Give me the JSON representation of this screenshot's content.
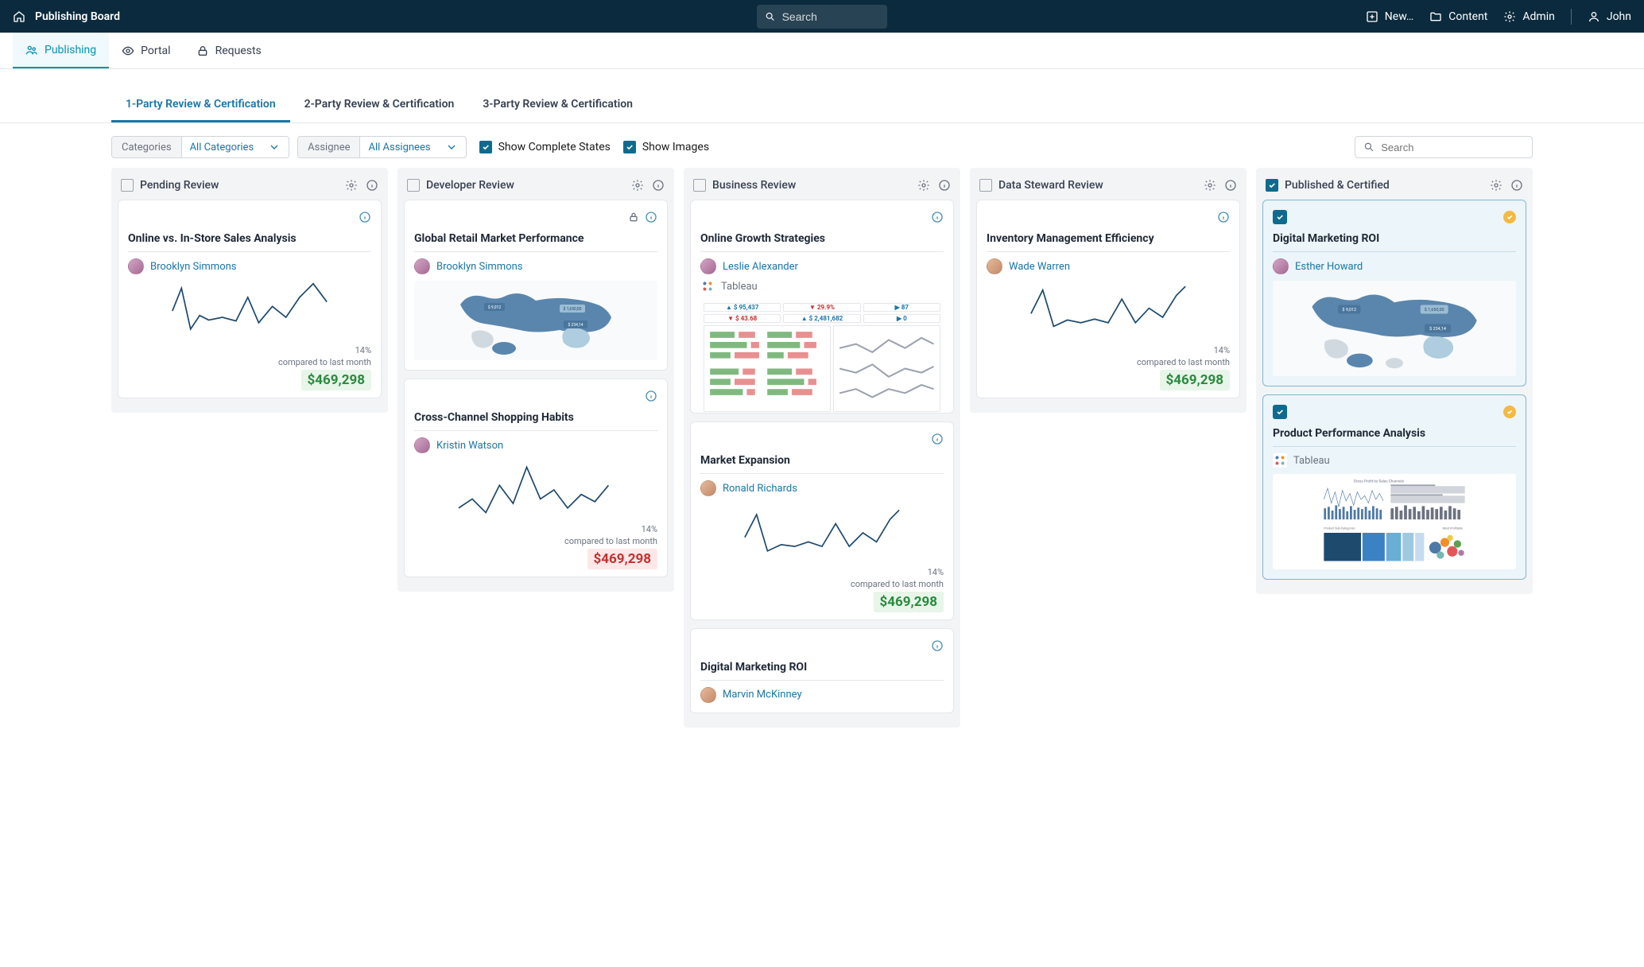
{
  "topbar": {
    "title": "Publishing Board",
    "search_placeholder": "Search",
    "actions": {
      "new": "New…",
      "content": "Content",
      "admin": "Admin",
      "user": "John"
    }
  },
  "nav": {
    "items": [
      {
        "label": "Publishing",
        "active": true
      },
      {
        "label": "Portal",
        "active": false
      },
      {
        "label": "Requests",
        "active": false
      }
    ]
  },
  "subtabs": {
    "items": [
      {
        "label": "1-Party Review & Certification",
        "active": true
      },
      {
        "label": "2-Party Review & Certification",
        "active": false
      },
      {
        "label": "3-Party Review & Certification",
        "active": false
      }
    ]
  },
  "toolbar": {
    "categories_label": "Categories",
    "categories_value": "All Categories",
    "assignee_label": "Assignee",
    "assignee_value": "All Assignees",
    "show_complete": "Show Complete States",
    "show_images": "Show Images",
    "search_placeholder": "Search"
  },
  "columns": [
    {
      "title": "Pending Review",
      "checked": false,
      "cards": [
        {
          "title": "Online vs. In-Store Sales Analysis",
          "assignee": "Brooklyn Simmons",
          "viz": "spark",
          "pct": "14%",
          "compared": "compared to last month",
          "amount": "$469,298",
          "neg": false
        }
      ]
    },
    {
      "title": "Developer Review",
      "checked": false,
      "cards": [
        {
          "title": "Global Retail Market Performance",
          "assignee": "Brooklyn Simmons",
          "viz": "map",
          "locked": true
        },
        {
          "title": "Cross-Channel Shopping Habits",
          "assignee": "Kristin Watson",
          "viz": "spark",
          "pct": "14%",
          "compared": "compared to last month",
          "amount": "$469,298",
          "neg": true
        }
      ]
    },
    {
      "title": "Business Review",
      "checked": false,
      "cards": [
        {
          "title": "Online Growth Strategies",
          "assignee": "Leslie Alexander",
          "source": "Tableau",
          "viz": "dash"
        },
        {
          "title": "Market Expansion",
          "assignee": "Ronald Richards",
          "viz": "spark",
          "pct": "14%",
          "compared": "compared to last month",
          "amount": "$469,298",
          "neg": false
        },
        {
          "title": "Digital Marketing ROI",
          "assignee": "Marvin McKinney",
          "viz": "none"
        }
      ]
    },
    {
      "title": "Data Steward Review",
      "checked": false,
      "cards": [
        {
          "title": "Inventory Management Efficiency",
          "assignee": "Wade Warren",
          "viz": "spark",
          "pct": "14%",
          "compared": "compared to last month",
          "amount": "$469,298",
          "neg": false
        }
      ]
    },
    {
      "title": "Published & Certified",
      "checked": true,
      "cards": [
        {
          "title": "Digital Marketing ROI",
          "assignee": "Esther Howard",
          "viz": "map",
          "published": true
        },
        {
          "title": "Product Performance Analysis",
          "source": "Tableau",
          "viz": "chart",
          "published": true
        }
      ]
    }
  ],
  "dash_stats": {
    "v1": "▲ $ 95,437",
    "v2": "▼ 29.9%",
    "v3": "▶ 87",
    "v4": "▼ $ 43.68",
    "v5": "▲ $ 2,481,682",
    "v6": "▶ 0"
  },
  "map_labels": {
    "a": "$ 9,012",
    "b": "$ 1,650,00",
    "c": "$ 234,14"
  },
  "chart_label": "Gross Profit by Sales Channels",
  "chart_sub": "Product Sub-Categories",
  "chart_profit": "Most Profitable"
}
